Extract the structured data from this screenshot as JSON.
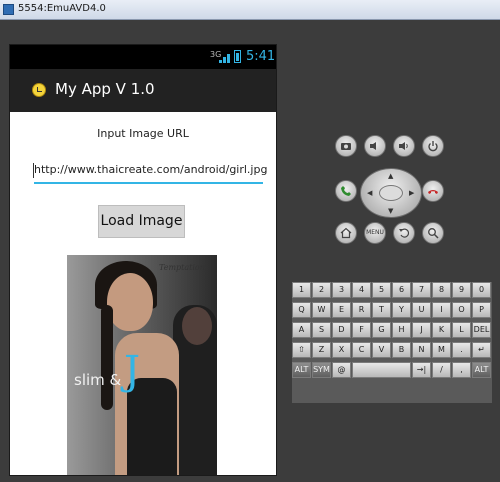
{
  "window": {
    "title": "5554:EmuAVD4.0"
  },
  "status_bar": {
    "signal": "3G",
    "time": "5:41"
  },
  "action_bar": {
    "title": "My App V 1.0"
  },
  "main": {
    "label": "Input Image URL",
    "url_value": "http://www.thaicreate.com/android/girl.jpg",
    "load_button": "Load Image",
    "image": {
      "title": "Temptation",
      "subtitle": "slim &",
      "accent": "J"
    }
  },
  "controls": {
    "buttons": [
      {
        "id": "camera",
        "label": "",
        "icon": "camera-icon"
      },
      {
        "id": "vol_down",
        "label": "",
        "icon": "volume-down-icon"
      },
      {
        "id": "vol_up",
        "label": "",
        "icon": "volume-up-icon"
      },
      {
        "id": "power",
        "label": "",
        "icon": "power-icon"
      },
      {
        "id": "call",
        "label": "",
        "icon": "call-icon"
      },
      {
        "id": "end_call",
        "label": "",
        "icon": "end-call-icon"
      },
      {
        "id": "home",
        "label": "",
        "icon": "home-icon"
      },
      {
        "id": "menu",
        "label": "MENU",
        "icon": "menu-icon"
      },
      {
        "id": "back",
        "label": "",
        "icon": "back-icon"
      },
      {
        "id": "search",
        "label": "",
        "icon": "search-icon"
      }
    ]
  },
  "keyboard": {
    "rows": [
      [
        "1",
        "2",
        "3",
        "4",
        "5",
        "6",
        "7",
        "8",
        "9",
        "0"
      ],
      [
        "Q",
        "W",
        "E",
        "R",
        "T",
        "Y",
        "U",
        "I",
        "O",
        "P"
      ],
      [
        "A",
        "S",
        "D",
        "F",
        "G",
        "H",
        "J",
        "K",
        "L",
        "DEL"
      ],
      [
        "⇧",
        "Z",
        "X",
        "C",
        "V",
        "B",
        "N",
        "M",
        ".",
        "↵"
      ],
      [
        "ALT",
        "SYM",
        "@",
        "",
        "→|",
        "/",
        ",",
        "ALT"
      ]
    ]
  },
  "colors": {
    "accent": "#33b5e5",
    "emulator_bg": "#3c3c3c",
    "action_bar": "#222222",
    "content_bg": "#ffffff"
  }
}
